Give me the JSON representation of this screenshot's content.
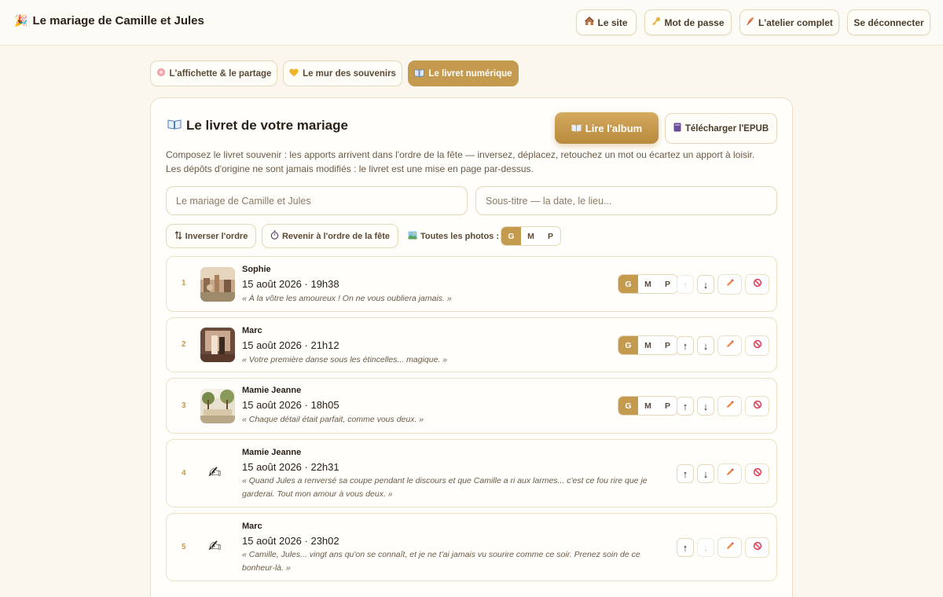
{
  "header": {
    "title": "Le mariage de Camille et Jules",
    "buttons": {
      "site": "Le site",
      "password": "Mot de passe",
      "workshop": "L'atelier complet",
      "logout": "Se déconnecter"
    }
  },
  "tabs": [
    {
      "label": "L'affichette & le partage",
      "active": false
    },
    {
      "label": "Le mur des souvenirs",
      "active": false
    },
    {
      "label": "Le livret numérique",
      "active": true
    }
  ],
  "booklet": {
    "title": "Le livret de votre mariage",
    "read_button": "Lire l'album",
    "download_button": "Télécharger l'EPUB",
    "description": "Composez le livret souvenir : les apports arrivent dans l'ordre de la fête — inversez, déplacez, retouchez un mot ou écartez un apport à loisir. Les dépôts d'origine ne sont jamais modifiés : le livret est une mise en page par-dessus.",
    "title_field": {
      "value": "",
      "placeholder": "Le mariage de Camille et Jules"
    },
    "subtitle_field": {
      "value": "",
      "placeholder": "Sous-titre — la date, le lieu..."
    },
    "invert_button": "Inverser l'ordre",
    "reset_button": "Revenir à l'ordre de la fête",
    "all_photos_label": "Toutes les photos :",
    "size_options": [
      "G",
      "M",
      "P"
    ],
    "selected_size": "G"
  },
  "entries": [
    {
      "num": "1",
      "author": "Sophie",
      "timestamp": "15 août 2026 · 19h38",
      "quote": "« À la vôtre les amoureux ! On ne vous oubliera jamais. »",
      "has_photo": true,
      "size": "G",
      "up_enabled": false,
      "down_enabled": true
    },
    {
      "num": "2",
      "author": "Marc",
      "timestamp": "15 août 2026 · 21h12",
      "quote": "« Votre première danse sous les étincelles... magique. »",
      "has_photo": true,
      "size": "G",
      "up_enabled": true,
      "down_enabled": true
    },
    {
      "num": "3",
      "author": "Mamie Jeanne",
      "timestamp": "15 août 2026 · 18h05",
      "quote": "« Chaque détail était parfait, comme vous deux. »",
      "has_photo": true,
      "size": "G",
      "up_enabled": true,
      "down_enabled": true
    },
    {
      "num": "4",
      "author": "Mamie Jeanne",
      "timestamp": "15 août 2026 · 22h31",
      "quote": "« Quand Jules a renversé sa coupe pendant le discours et que Camille a ri aux larmes... c'est ce fou rire que je garderai. Tout mon amour à vous deux. »",
      "has_photo": false,
      "up_enabled": true,
      "down_enabled": true
    },
    {
      "num": "5",
      "author": "Marc",
      "timestamp": "15 août 2026 · 23h02",
      "quote": "« Camille, Jules... vingt ans qu'on se connaît, et je ne t'ai jamais vu sourire comme ce soir. Prenez soin de ce bonheur-là. »",
      "has_photo": false,
      "up_enabled": true,
      "down_enabled": false
    }
  ],
  "icons": {
    "brand": "party-popper-icon",
    "text_entry": "writing-hand-icon"
  },
  "colors": {
    "accent": "#c49a4e",
    "background": "#fbf7ef",
    "danger": "#e0455e"
  }
}
